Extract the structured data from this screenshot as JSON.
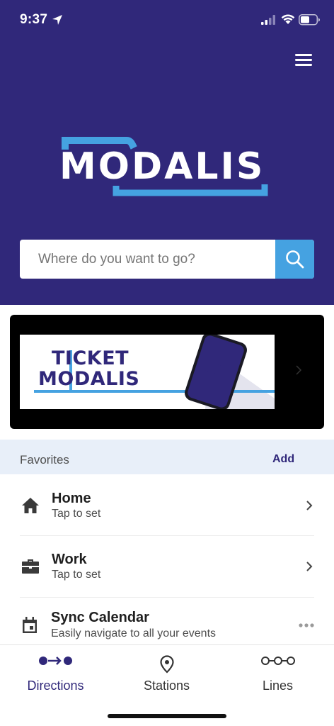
{
  "status_bar": {
    "time": "9:37"
  },
  "logo": {
    "text": "MODALIS"
  },
  "search": {
    "placeholder": "Where do you want to go?"
  },
  "banner": {
    "line1": "TICKET",
    "line2": "MODALIS"
  },
  "favorites": {
    "title": "Favorites",
    "add_label": "Add",
    "items": [
      {
        "title": "Home",
        "subtitle": "Tap to set",
        "icon": "home-icon"
      },
      {
        "title": "Work",
        "subtitle": "Tap to set",
        "icon": "briefcase-icon"
      },
      {
        "title": "Sync Calendar",
        "subtitle": "Easily navigate to all your events",
        "icon": "calendar-icon"
      }
    ]
  },
  "tabs": [
    {
      "label": "Directions",
      "icon": "directions-icon",
      "active": true
    },
    {
      "label": "Stations",
      "icon": "location-pin-icon",
      "active": false
    },
    {
      "label": "Lines",
      "icon": "lines-icon",
      "active": false
    }
  ],
  "colors": {
    "brand": "#30287a",
    "accent": "#45a2e1",
    "favorites_bg": "#e8eff9"
  }
}
